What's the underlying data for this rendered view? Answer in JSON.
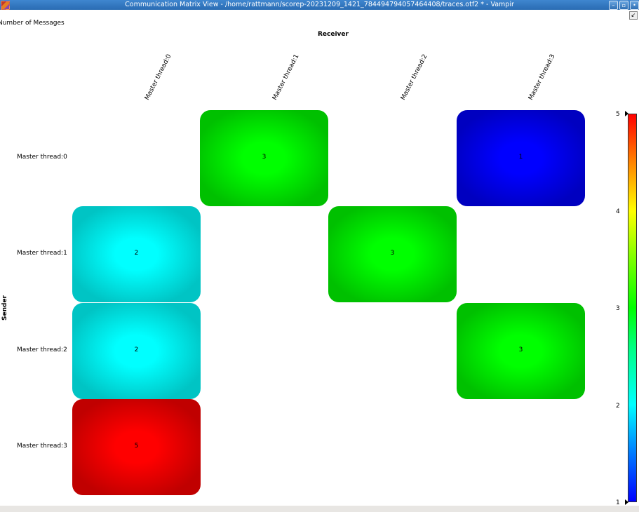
{
  "window": {
    "title": "Communication Matrix View - /home/rattmann/scorep-20231209_1421_784494794057464408/traces.otf2 * - Vampir",
    "controls": [
      "minimize-icon",
      "maximize-icon",
      "close-icon"
    ]
  },
  "metric_label": "Number of Messages",
  "axis": {
    "receiver": "Receiver",
    "sender": "Sender"
  },
  "columns": [
    "Master thread:0",
    "Master thread:1",
    "Master thread:2",
    "Master thread:3"
  ],
  "rows": [
    "Master thread:0",
    "Master thread:1",
    "Master thread:2",
    "Master thread:3"
  ],
  "cells": [
    {
      "row": 0,
      "col": 1,
      "value": "3",
      "color": "#00ff00",
      "edge": "#00c000"
    },
    {
      "row": 0,
      "col": 3,
      "value": "1",
      "color": "#0000ff",
      "edge": "#0000c0"
    },
    {
      "row": 1,
      "col": 0,
      "value": "2",
      "color": "#00ffff",
      "edge": "#00c4c4"
    },
    {
      "row": 1,
      "col": 2,
      "value": "3",
      "color": "#00ff00",
      "edge": "#00c000"
    },
    {
      "row": 2,
      "col": 0,
      "value": "2",
      "color": "#00ffff",
      "edge": "#00c4c4"
    },
    {
      "row": 2,
      "col": 3,
      "value": "3",
      "color": "#00ff00",
      "edge": "#00c000"
    },
    {
      "row": 3,
      "col": 0,
      "value": "5",
      "color": "#ff0000",
      "edge": "#c00000"
    }
  ],
  "legend": {
    "max": "5",
    "t4": "4",
    "t3": "3",
    "t2": "2",
    "min": "1"
  }
}
